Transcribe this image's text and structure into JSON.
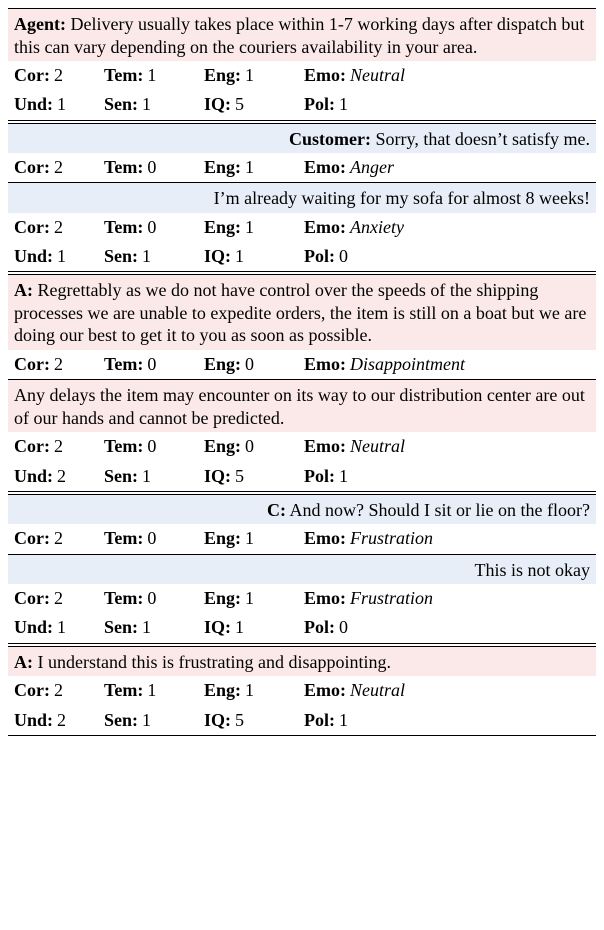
{
  "labels": {
    "cor": "Cor:",
    "tem": "Tem:",
    "eng": "Eng:",
    "emo": "Emo:",
    "und": "Und:",
    "sen": "Sen:",
    "iq": "IQ:",
    "pol": "Pol:"
  },
  "turns": [
    {
      "role": "agent",
      "speaker": "Agent:",
      "text": "Delivery usually takes place within 1-7 working days after dispatch but this can vary depending on the couriers availability in your area.",
      "row1": {
        "cor": "2",
        "tem": "1",
        "eng": "1",
        "emo": "Neutral"
      },
      "row2": {
        "und": "1",
        "sen": "1",
        "iq": "5",
        "pol": "1"
      }
    },
    {
      "role": "customer",
      "speaker": "Customer:",
      "text": "Sorry, that doesn’t satisfy me.",
      "row1": {
        "cor": "2",
        "tem": "0",
        "eng": "1",
        "emo": "Anger"
      }
    },
    {
      "role": "customer",
      "text": "I’m already waiting for my sofa for almost 8 weeks!",
      "row1": {
        "cor": "2",
        "tem": "0",
        "eng": "1",
        "emo": "Anxiety"
      },
      "row2": {
        "und": "1",
        "sen": "1",
        "iq": "1",
        "pol": "0"
      }
    },
    {
      "role": "agent",
      "speaker": "A:",
      "text": "Regrettably as we do not have control over the speeds of the shipping processes we are unable to expedite orders, the item is still on a boat but we are doing our best to get it to you as soon as possible.",
      "row1": {
        "cor": "2",
        "tem": "0",
        "eng": "0",
        "emo": "Disappointment"
      }
    },
    {
      "role": "agent",
      "text": "Any delays the item may encounter on its way to our distribution center are out of our hands and cannot be predicted.",
      "row1": {
        "cor": "2",
        "tem": "0",
        "eng": "0",
        "emo": "Neutral"
      },
      "row2": {
        "und": "2",
        "sen": "1",
        "iq": "5",
        "pol": "1"
      }
    },
    {
      "role": "customer",
      "speaker": "C:",
      "text": "And now? Should I sit or lie on the floor?",
      "row1": {
        "cor": "2",
        "tem": "0",
        "eng": "1",
        "emo": "Frustration"
      }
    },
    {
      "role": "customer",
      "text": "This is not okay",
      "row1": {
        "cor": "2",
        "tem": "0",
        "eng": "1",
        "emo": "Frustration"
      },
      "row2": {
        "und": "1",
        "sen": "1",
        "iq": "1",
        "pol": "0"
      }
    },
    {
      "role": "agent",
      "speaker": "A:",
      "text": "I understand this is frustrating and disappointing.",
      "row1": {
        "cor": "2",
        "tem": "1",
        "eng": "1",
        "emo": "Neutral"
      },
      "row2": {
        "und": "2",
        "sen": "1",
        "iq": "5",
        "pol": "1"
      }
    }
  ]
}
